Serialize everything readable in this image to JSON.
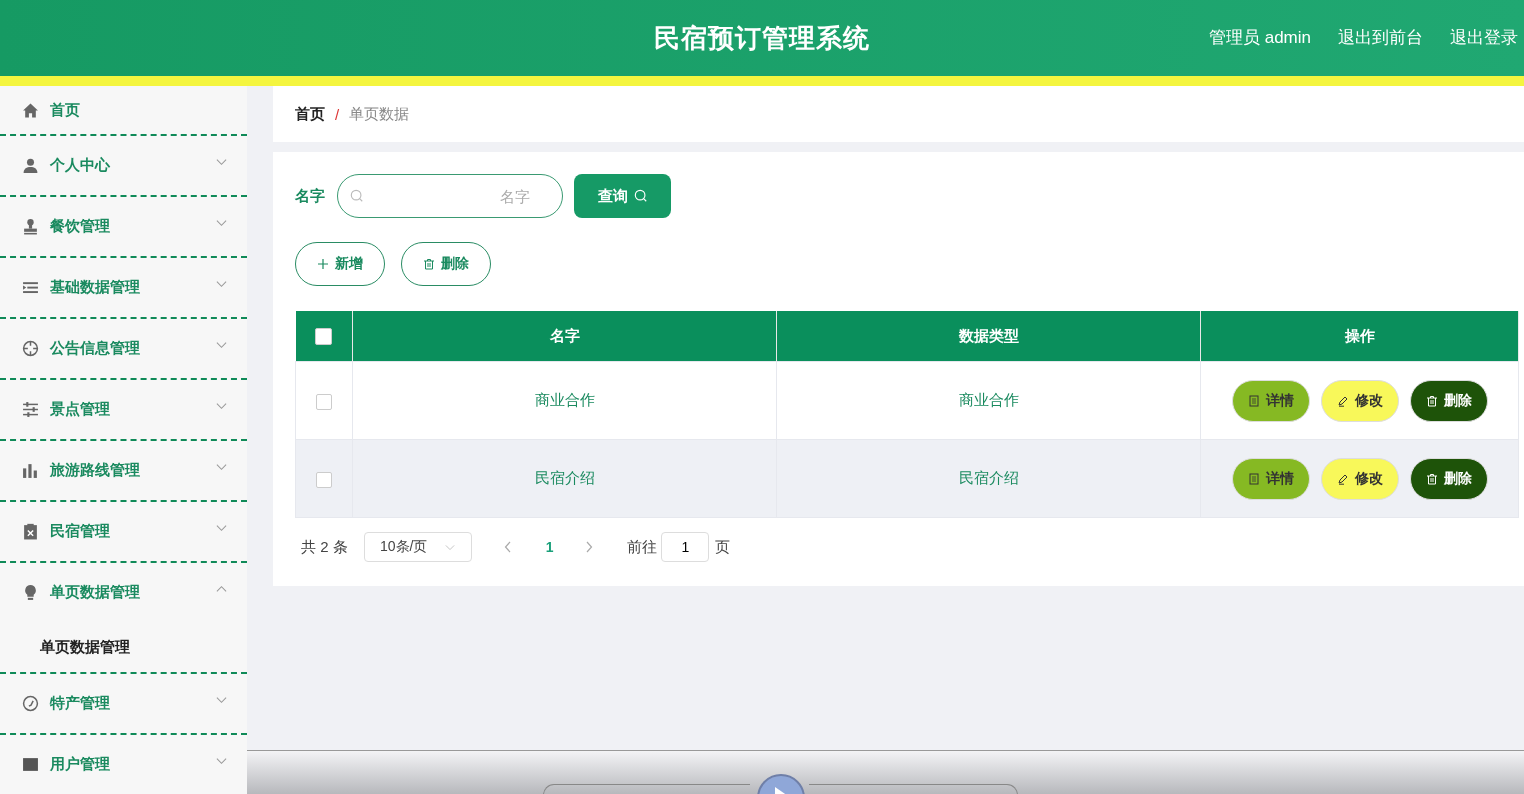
{
  "header": {
    "title": "民宿预订管理系统",
    "links": [
      "管理员 admin",
      "退出到前台",
      "退出登录"
    ]
  },
  "sidebar": {
    "items": [
      {
        "label": "首页",
        "kind": "link"
      },
      {
        "label": "个人中心",
        "kind": "submenu",
        "expanded": false
      },
      {
        "label": "餐饮管理",
        "kind": "submenu",
        "expanded": false
      },
      {
        "label": "基础数据管理",
        "kind": "submenu",
        "expanded": false
      },
      {
        "label": "公告信息管理",
        "kind": "submenu",
        "expanded": false
      },
      {
        "label": "景点管理",
        "kind": "submenu",
        "expanded": false
      },
      {
        "label": "旅游路线管理",
        "kind": "submenu",
        "expanded": false
      },
      {
        "label": "民宿管理",
        "kind": "submenu",
        "expanded": false
      },
      {
        "label": "单页数据管理",
        "kind": "submenu",
        "expanded": true,
        "children": [
          {
            "label": "单页数据管理"
          }
        ]
      },
      {
        "label": "特产管理",
        "kind": "submenu",
        "expanded": false
      },
      {
        "label": "用户管理",
        "kind": "submenu",
        "expanded": false
      }
    ]
  },
  "breadcrumb": [
    "首页",
    "单页数据"
  ],
  "breadcrumb_separator": "/",
  "search": {
    "label": "名字",
    "placeholder": "名字",
    "button": "查询"
  },
  "actions": [
    "新增",
    "删除"
  ],
  "table": {
    "columns": [
      "名字",
      "数据类型",
      "操作"
    ],
    "all_checked": false,
    "rows": [
      {
        "cells": [
          "商业合作",
          "商业合作"
        ],
        "checked": false,
        "buttons": [
          "详情",
          "修改",
          "删除"
        ]
      },
      {
        "cells": [
          "民宿介绍",
          "民宿介绍"
        ],
        "checked": false,
        "buttons": [
          "详情",
          "修改",
          "删除"
        ]
      }
    ]
  },
  "pagination": {
    "total": "共 2 条",
    "page_size": "10条/页",
    "pages": [
      {
        "label": "1",
        "selected": true
      }
    ],
    "goto_label": "前往",
    "goto_value": "1",
    "goto_suffix": "页"
  }
}
